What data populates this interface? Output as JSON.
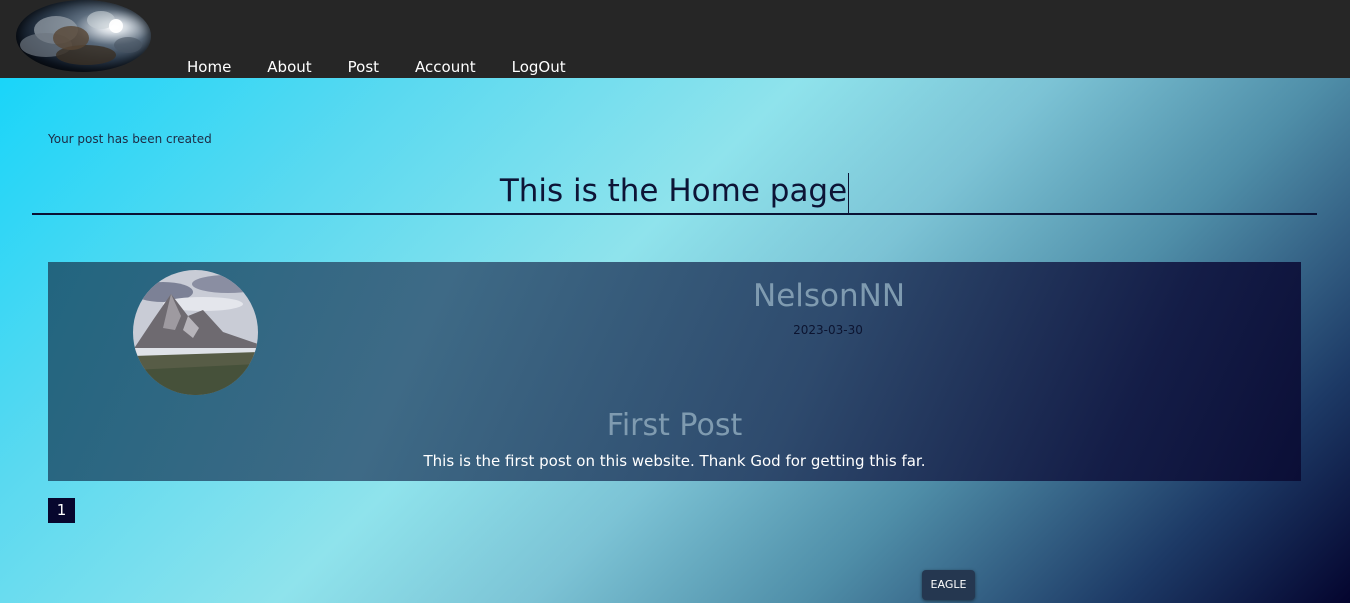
{
  "nav": {
    "logo_icon": "earth-storm-logo",
    "links": [
      "Home",
      "About",
      "Post",
      "Account",
      "LogOut"
    ]
  },
  "flash_message": "Your post has been created",
  "page_title": "This is the Home page",
  "posts": [
    {
      "avatar_icon": "mountain-avatar",
      "author": "NelsonNN",
      "date": "2023-03-30",
      "title": "First Post",
      "body": "This is the first post on this website. Thank God for getting this far."
    }
  ],
  "pagination": {
    "current_page": "1"
  },
  "footer": {
    "badge_label": "EAGLE"
  },
  "colors": {
    "navbar_bg": "#262626",
    "page_button_bg": "#07072e",
    "title_text": "#0d1436",
    "author_text": "#7f9bb0"
  }
}
